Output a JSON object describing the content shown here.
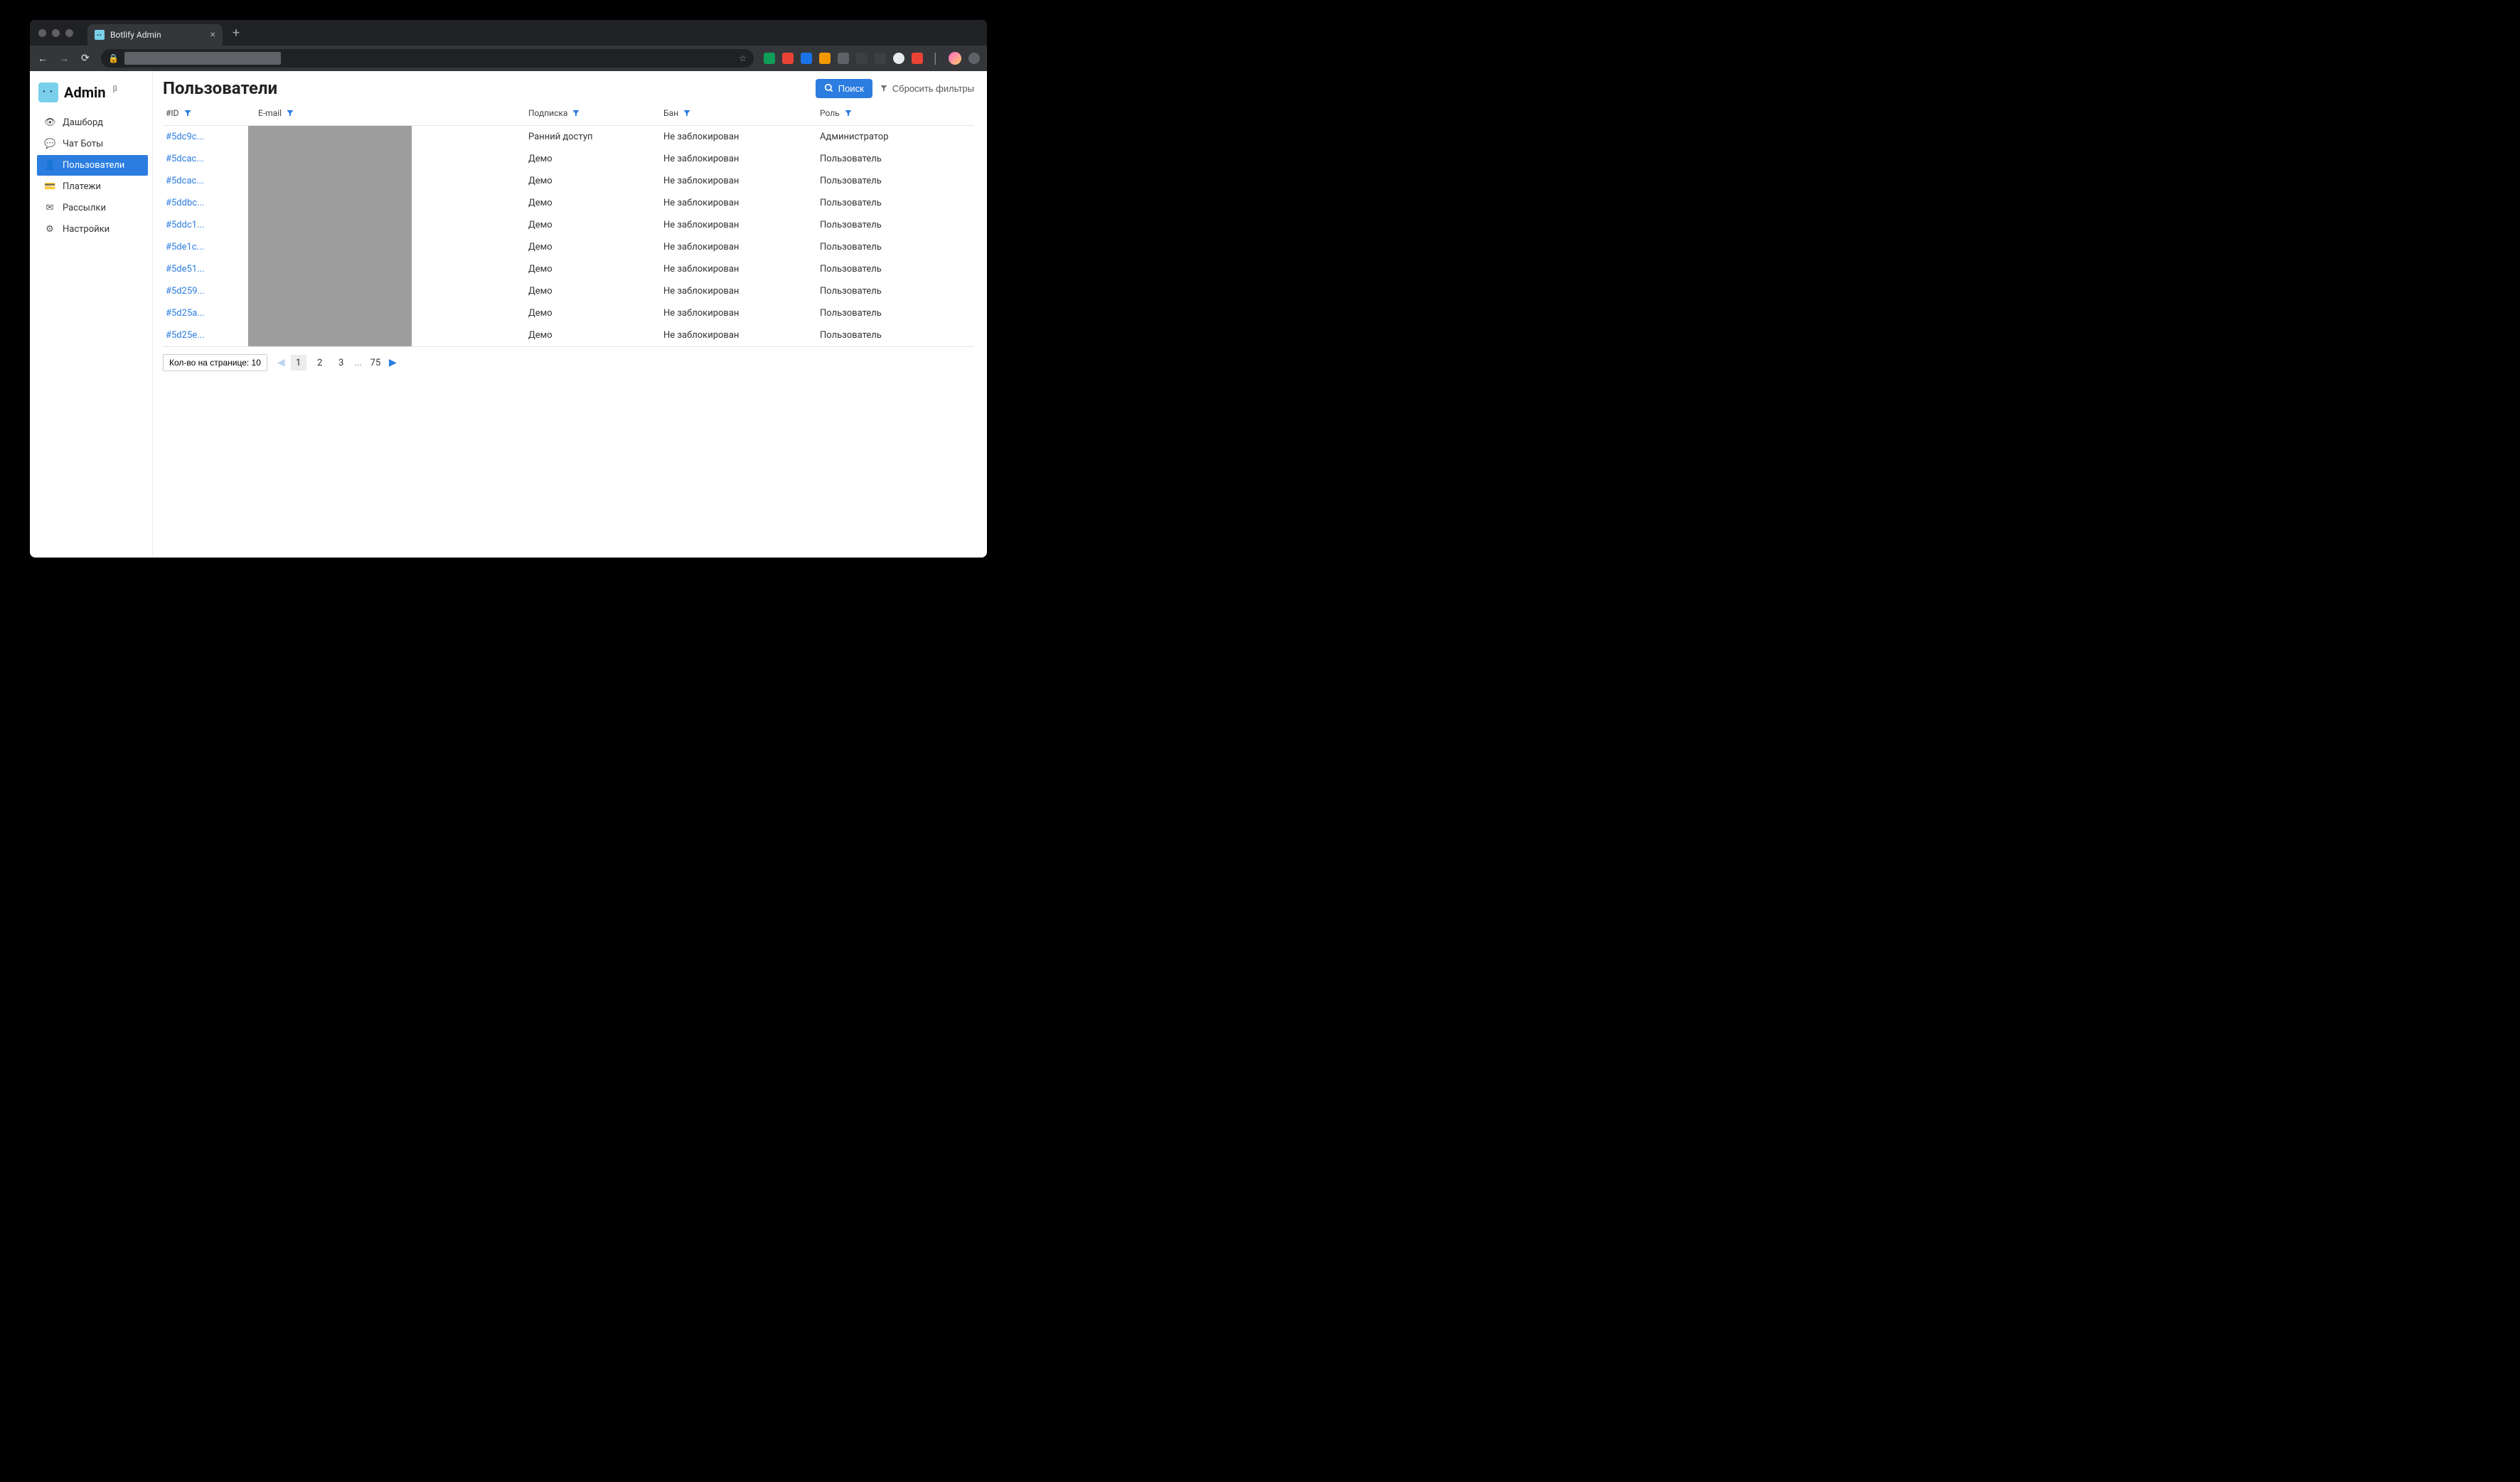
{
  "browser": {
    "tab_title": "Botlify Admin"
  },
  "brand": {
    "name": "Admin",
    "beta": "β"
  },
  "sidebar": {
    "items": [
      {
        "icon": "eye-icon",
        "glyph": "👁",
        "label": "Дашборд"
      },
      {
        "icon": "chat-icon",
        "glyph": "💬",
        "label": "Чат Боты"
      },
      {
        "icon": "user-icon",
        "glyph": "👤",
        "label": "Пользователи",
        "active": true
      },
      {
        "icon": "card-icon",
        "glyph": "💳",
        "label": "Платежи"
      },
      {
        "icon": "mail-icon",
        "glyph": "✉",
        "label": "Рассылки"
      },
      {
        "icon": "gear-icon",
        "glyph": "⚙",
        "label": "Настройки"
      }
    ]
  },
  "page": {
    "title": "Пользователи",
    "search_label": "Поиск",
    "reset_label": "Сбросить фильтры"
  },
  "columns": {
    "id": "#ID",
    "email": "E-mail",
    "subscription": "Подписка",
    "ban": "Бан",
    "role": "Роль"
  },
  "rows": [
    {
      "id": "#5dc9c...",
      "subscription": "Ранний доступ",
      "ban": "Не заблокирован",
      "role": "Администратор"
    },
    {
      "id": "#5dcac...",
      "subscription": "Демо",
      "ban": "Не заблокирован",
      "role": "Пользователь"
    },
    {
      "id": "#5dcac...",
      "subscription": "Демо",
      "ban": "Не заблокирован",
      "role": "Пользователь"
    },
    {
      "id": "#5ddbc...",
      "subscription": "Демо",
      "ban": "Не заблокирован",
      "role": "Пользователь"
    },
    {
      "id": "#5ddc1...",
      "subscription": "Демо",
      "ban": "Не заблокирован",
      "role": "Пользователь"
    },
    {
      "id": "#5de1c...",
      "subscription": "Демо",
      "ban": "Не заблокирован",
      "role": "Пользователь"
    },
    {
      "id": "#5de51...",
      "subscription": "Демо",
      "ban": "Не заблокирован",
      "role": "Пользователь"
    },
    {
      "id": "#5d259...",
      "subscription": "Демо",
      "ban": "Не заблокирован",
      "role": "Пользователь"
    },
    {
      "id": "#5d25a...",
      "subscription": "Демо",
      "ban": "Не заблокирован",
      "role": "Пользователь"
    },
    {
      "id": "#5d25e...",
      "subscription": "Демо",
      "ban": "Не заблокирован",
      "role": "Пользователь"
    }
  ],
  "pagination": {
    "per_page_label": "Кол-во на странице: 10",
    "pages": [
      "1",
      "2",
      "3",
      "...",
      "75"
    ],
    "current": "1"
  }
}
